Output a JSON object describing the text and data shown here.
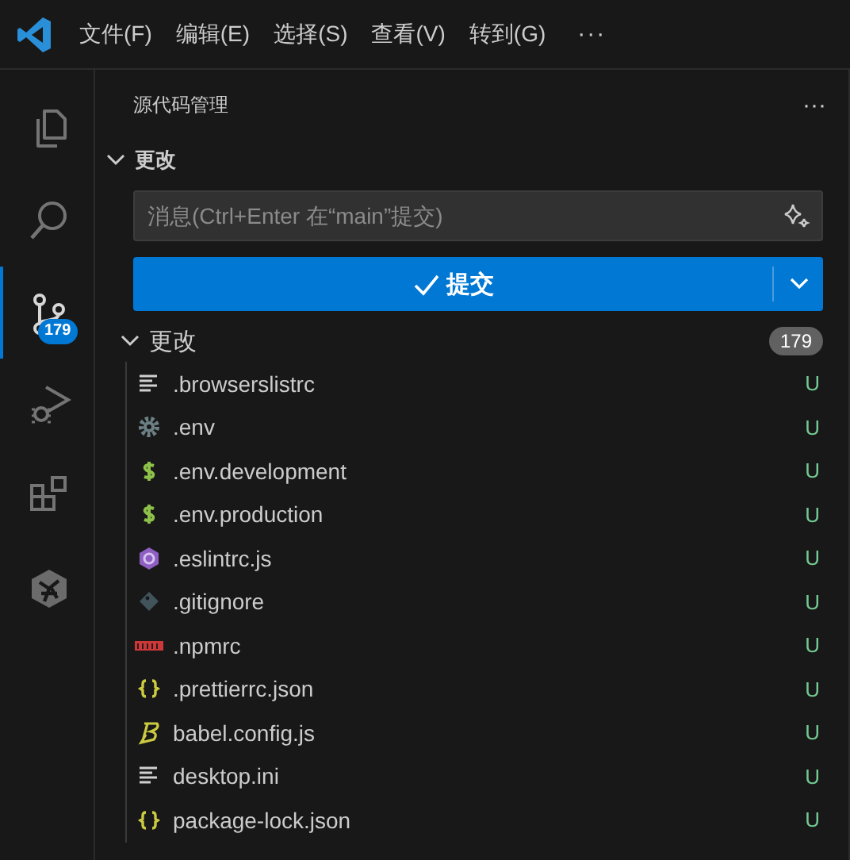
{
  "menu": [
    "文件(F)",
    "编辑(E)",
    "选择(S)",
    "查看(V)",
    "转到(G)"
  ],
  "more": "···",
  "activity": [
    {
      "kind": "files",
      "selected": false
    },
    {
      "kind": "search",
      "selected": false
    },
    {
      "kind": "scm",
      "selected": true,
      "badge": "179"
    },
    {
      "kind": "debug",
      "selected": false
    },
    {
      "kind": "extensions",
      "selected": false
    },
    {
      "kind": "other",
      "selected": false
    }
  ],
  "sidebar": {
    "title": "源代码管理",
    "more": "···",
    "section": {
      "label": "更改",
      "expanded": true
    },
    "message": {
      "placeholder": "消息(Ctrl+Enter 在“main”提交)"
    },
    "commit_button": "提交",
    "changes": {
      "label": "更改",
      "expanded": true,
      "count": "179",
      "files": [
        {
          "name": ".browserslistrc",
          "kind": "lines",
          "status": "U"
        },
        {
          "name": ".env",
          "kind": "gear",
          "status": "U"
        },
        {
          "name": ".env.development",
          "kind": "dollar",
          "status": "U"
        },
        {
          "name": ".env.production",
          "kind": "dollar",
          "status": "U"
        },
        {
          "name": ".eslintrc.js",
          "kind": "eslint",
          "status": "U"
        },
        {
          "name": ".gitignore",
          "kind": "git",
          "status": "U"
        },
        {
          "name": ".npmrc",
          "kind": "npm",
          "status": "U"
        },
        {
          "name": ".prettierrc.json",
          "kind": "braces",
          "status": "U"
        },
        {
          "name": "babel.config.js",
          "kind": "babel",
          "status": "U"
        },
        {
          "name": "desktop.ini",
          "kind": "lines",
          "status": "U"
        },
        {
          "name": "package-lock.json",
          "kind": "braces",
          "status": "U"
        }
      ]
    }
  }
}
